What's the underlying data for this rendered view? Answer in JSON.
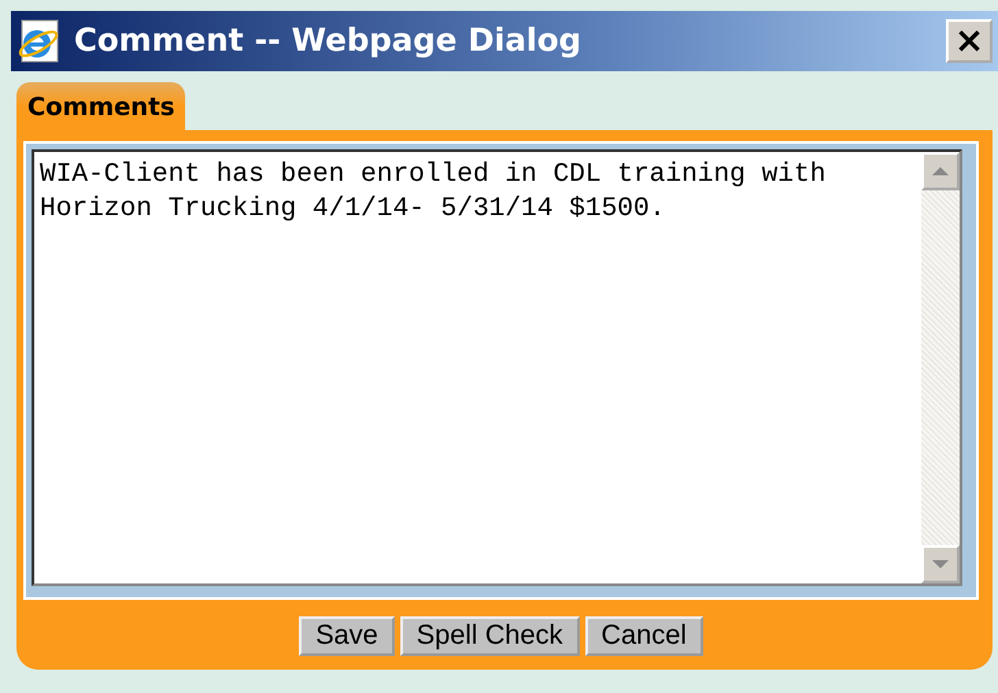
{
  "window": {
    "title": "Comment -- Webpage Dialog",
    "close": "×"
  },
  "tabs": [
    {
      "label": "Comments",
      "selected": true
    }
  ],
  "comment": {
    "value": "WIA-Client has been enrolled in CDL training with Horizon Trucking 4/1/14- 5/31/14 $1500."
  },
  "buttons": [
    "Save",
    "Spell Check",
    "Cancel"
  ]
}
